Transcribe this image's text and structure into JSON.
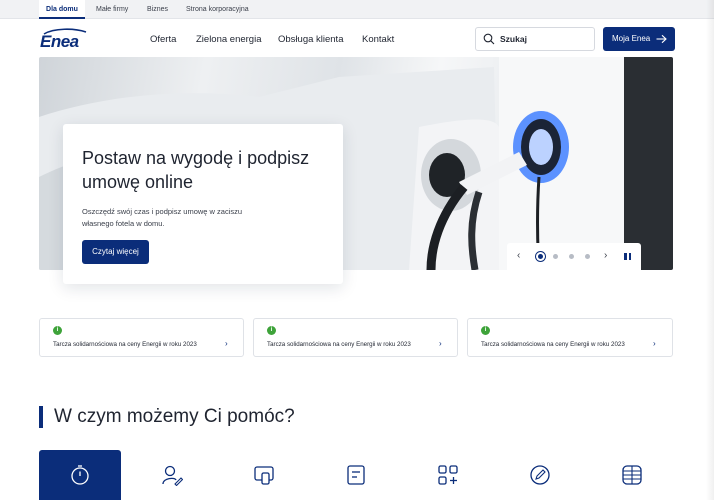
{
  "segments": {
    "items": [
      "Dla domu",
      "Małe firmy",
      "Biznes",
      "Strona korporacyjna"
    ],
    "active": "Dla domu"
  },
  "header": {
    "logo_text": "Enea",
    "nav": [
      "Oferta",
      "Zielona energia",
      "Obsługa klienta",
      "Kontakt"
    ],
    "search_placeholder": "Szukaj",
    "account_label": "Moja Enea"
  },
  "hero": {
    "title": "Postaw na wygodę i podpisz umowę online",
    "text": "Oszczędź swój czas i podpisz umowę w zaciszu własnego fotela w domu.",
    "button": "Czytaj więcej",
    "slides_total": 4,
    "slide_active": 1
  },
  "notices": [
    {
      "badge": "i",
      "text": "Tarcza solidarnościowa na ceny Energii w roku 2023"
    },
    {
      "badge": "i",
      "text": "Tarcza solidarnościowa na ceny Energii w roku 2023"
    },
    {
      "badge": "i",
      "text": "Tarcza solidarnościowa na ceny Energii w roku 2023"
    }
  ],
  "help": {
    "title": "W czym możemy Ci pomóc?",
    "tiles": [
      {
        "icon": "stopwatch-icon",
        "label": ""
      },
      {
        "icon": "user-edit-icon",
        "label": ""
      },
      {
        "icon": "devices-icon",
        "label": ""
      },
      {
        "icon": "document-icon",
        "label": ""
      },
      {
        "icon": "grid-plus-icon",
        "label": ""
      },
      {
        "icon": "pencil-circle-icon",
        "label": ""
      },
      {
        "icon": "globe-icon",
        "label": ""
      }
    ]
  },
  "colors": {
    "brand": "#0b2d7a",
    "info_badge": "#3ea33a",
    "text": "#1f2430"
  }
}
